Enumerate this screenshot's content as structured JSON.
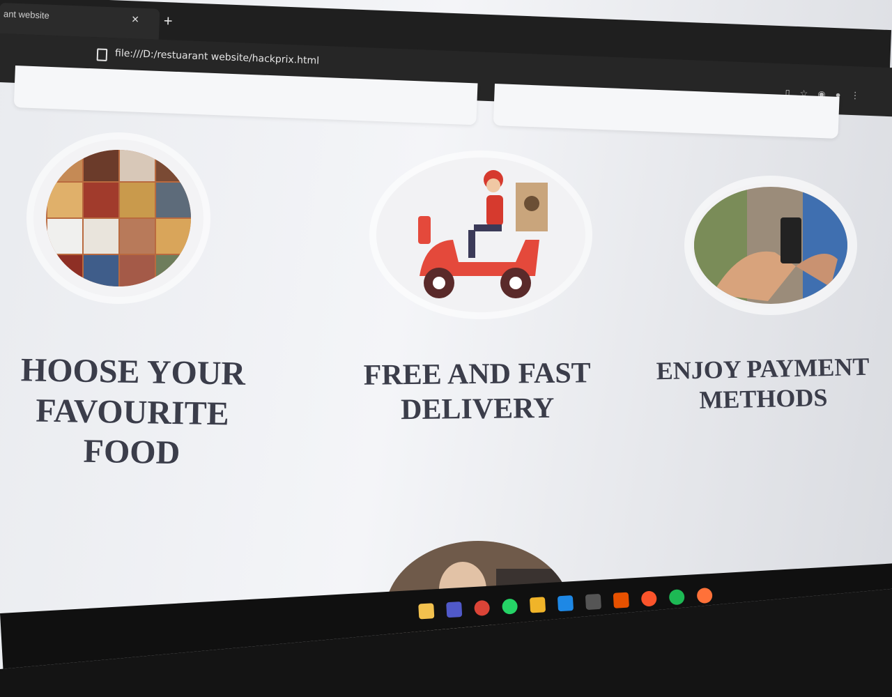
{
  "browser": {
    "tab_title": "ant website",
    "tab_close": "×",
    "new_tab": "+",
    "address": "file:///D:/restuarant website/hackprix.html"
  },
  "features": [
    {
      "icon": "food-collage-image",
      "line1": "HOOSE YOUR",
      "line2": "FAVOURITE",
      "line3": "FOOD"
    },
    {
      "icon": "delivery-scooter-image",
      "line1": "FREE AND FAST",
      "line2": "DELIVERY"
    },
    {
      "icon": "card-payment-image",
      "line1": "ENJOY PAYMENT",
      "line2": "METHODS"
    }
  ],
  "partial_image": "woman-eating-photo",
  "taskbar_apps": [
    "file-explorer",
    "teams",
    "chrome",
    "whatsapp",
    "folder",
    "vscode",
    "settings",
    "office",
    "brave",
    "spotify",
    "firefox"
  ],
  "colors": {
    "heading": "#3b3d4a",
    "delivery_red": "#e4493b",
    "taskbar": "#101010"
  }
}
